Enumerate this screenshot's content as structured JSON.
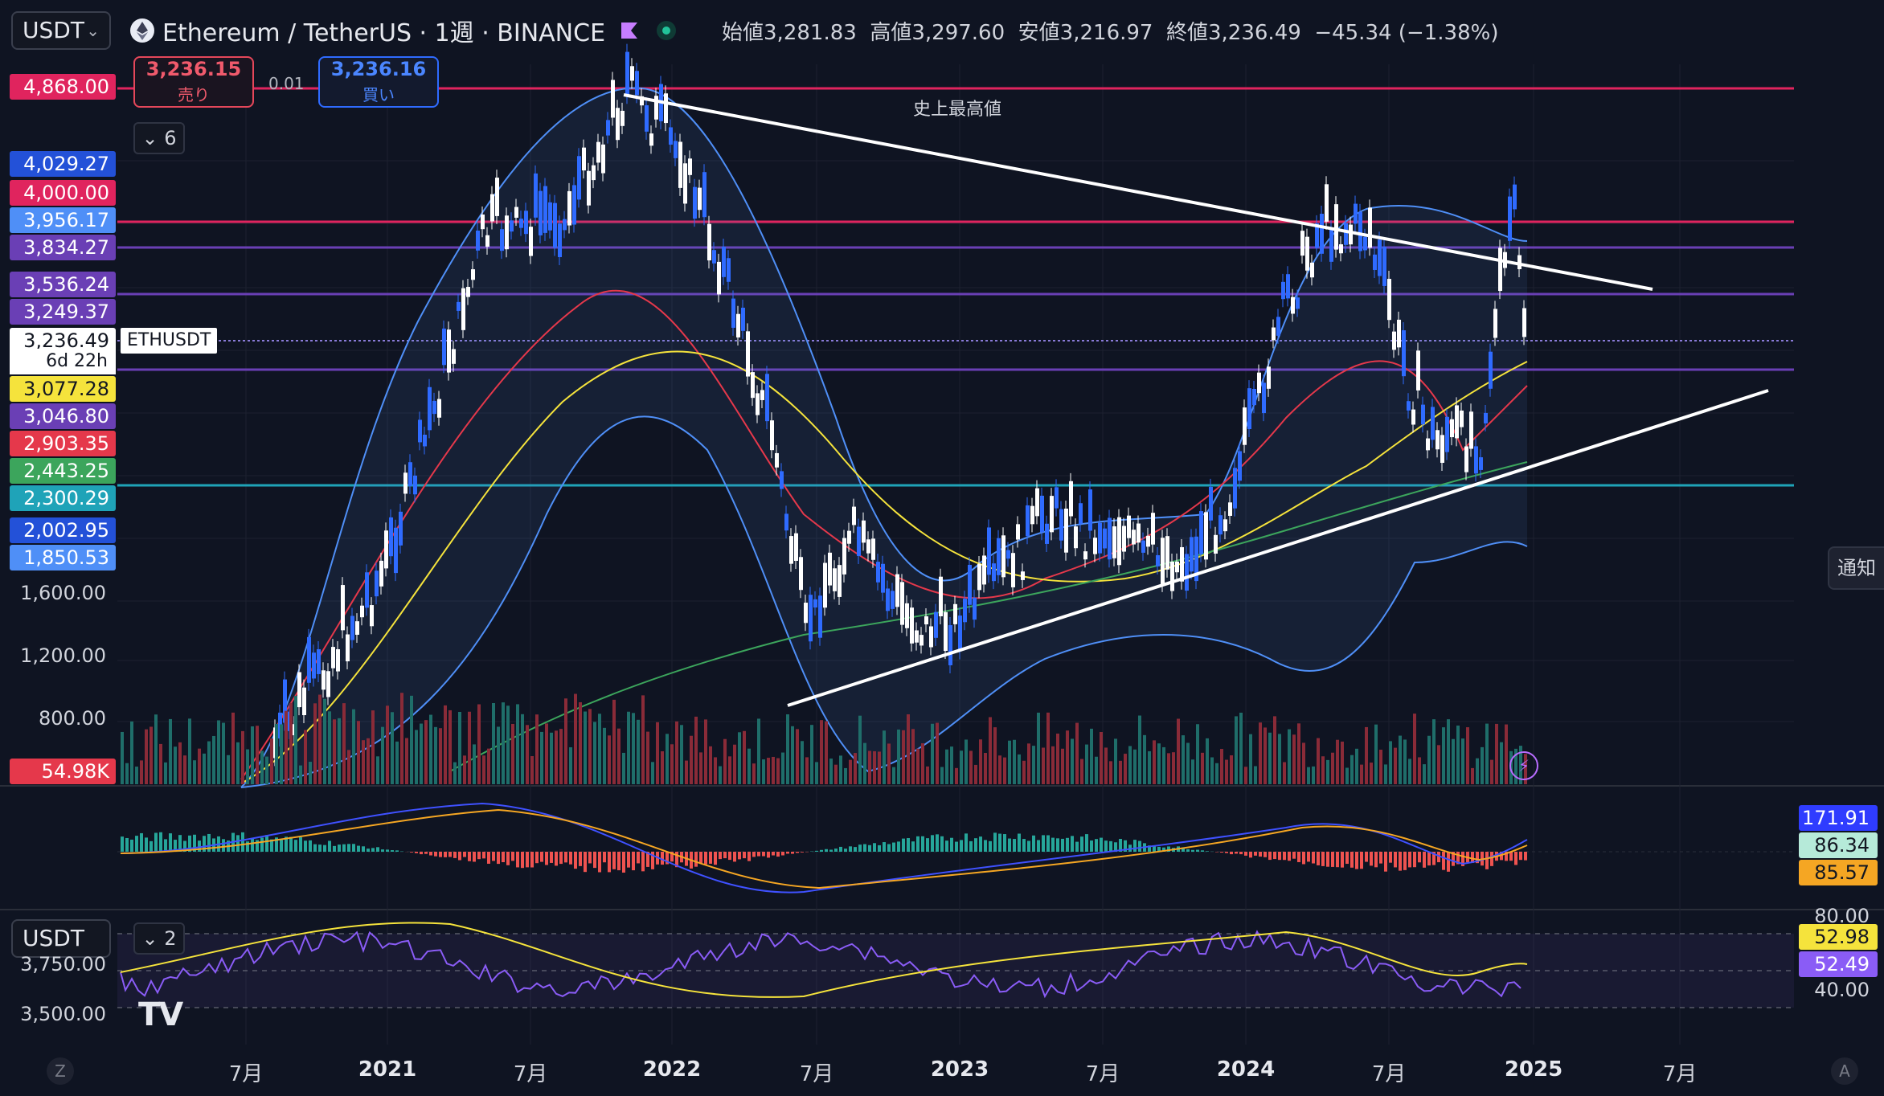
{
  "header": {
    "currency_select": "USDT",
    "symbol_title": "Ethereum / TetherUS · 1週 · BINANCE",
    "ohlc": {
      "open_label": "始値",
      "open": "3,281.83",
      "high_label": "高値",
      "high": "3,297.60",
      "low_label": "安値",
      "low": "3,216.97",
      "close_label": "終値",
      "close": "3,236.49",
      "change": "−45.34 (−1.38%)"
    }
  },
  "trade": {
    "sell_price": "3,236.15",
    "sell_label": "売り",
    "buy_price": "3,236.16",
    "buy_label": "買い",
    "spread": "0.01"
  },
  "indicators_toggle": "6",
  "annotation_ath": "史上最高値",
  "price_tags": [
    {
      "text": "4,868.00",
      "color": "#e0245e"
    },
    {
      "text": "4,029.27",
      "color": "#2351d8"
    },
    {
      "text": "4,000.00",
      "color": "#e0245e"
    },
    {
      "text": "3,956.17",
      "color": "#4f8ff7"
    },
    {
      "text": "3,834.27",
      "color": "#6a3fb5"
    },
    {
      "text": "3,536.24",
      "color": "#6a3fb5"
    },
    {
      "text": "3,249.37",
      "color": "#6a3fb5"
    },
    {
      "text": "3,077.28",
      "color": "#f5e33c"
    },
    {
      "text": "3,046.80",
      "color": "#6a3fb5"
    },
    {
      "text": "2,903.35",
      "color": "#e5384b"
    },
    {
      "text": "2,443.25",
      "color": "#3ca55c"
    },
    {
      "text": "2,300.29",
      "color": "#1fa3b8"
    },
    {
      "text": "2,002.95",
      "color": "#2351d8"
    },
    {
      "text": "1,850.53",
      "color": "#4f8ff7"
    }
  ],
  "last_price": {
    "value": "3,236.49",
    "symbol": "ETHUSDT",
    "countdown": "6d 22h"
  },
  "price_axis": [
    "1,600.00",
    "1,200.00",
    "800.00"
  ],
  "volume_tag": "54.98K",
  "macd_tags": [
    {
      "text": "171.91",
      "color": "#2f3cff"
    },
    {
      "text": "86.34",
      "color": "#b6ead9"
    },
    {
      "text": "85.57",
      "color": "#f5a623"
    }
  ],
  "rsi_panel": {
    "currency_select": "USDT",
    "indicators_toggle": "2",
    "levels": [
      "80.00",
      "40.00"
    ],
    "tags": [
      {
        "text": "52.98",
        "color": "#f5e33c"
      },
      {
        "text": "52.49",
        "color": "#8a5cf6"
      }
    ],
    "price_axis": [
      "3,750.00",
      "3,500.00"
    ]
  },
  "notify_label": "通知",
  "x_axis": [
    {
      "label": "7月",
      "year": false
    },
    {
      "label": "2021",
      "year": true
    },
    {
      "label": "7月",
      "year": false
    },
    {
      "label": "2022",
      "year": true
    },
    {
      "label": "7月",
      "year": false
    },
    {
      "label": "2023",
      "year": true
    },
    {
      "label": "7月",
      "year": false
    },
    {
      "label": "2024",
      "year": true
    },
    {
      "label": "7月",
      "year": false
    },
    {
      "label": "2025",
      "year": true
    },
    {
      "label": "7月",
      "year": false
    }
  ],
  "bottom_buttons": [
    "Z",
    "A"
  ],
  "logo": "TV",
  "colors": {
    "background": "#0f1422",
    "bull_candle": "#2f6bff",
    "bear_candle": "#ffffff",
    "resistance": "#e0245e",
    "fib_lines": "#6a3fb5",
    "support": "#1fa3b8",
    "trendline": "#ffffff",
    "bollinger": "#4f8ff7",
    "ma_fast": "#e5384b",
    "ma_mid": "#f5e33c",
    "ma_slow": "#3ca55c"
  }
}
